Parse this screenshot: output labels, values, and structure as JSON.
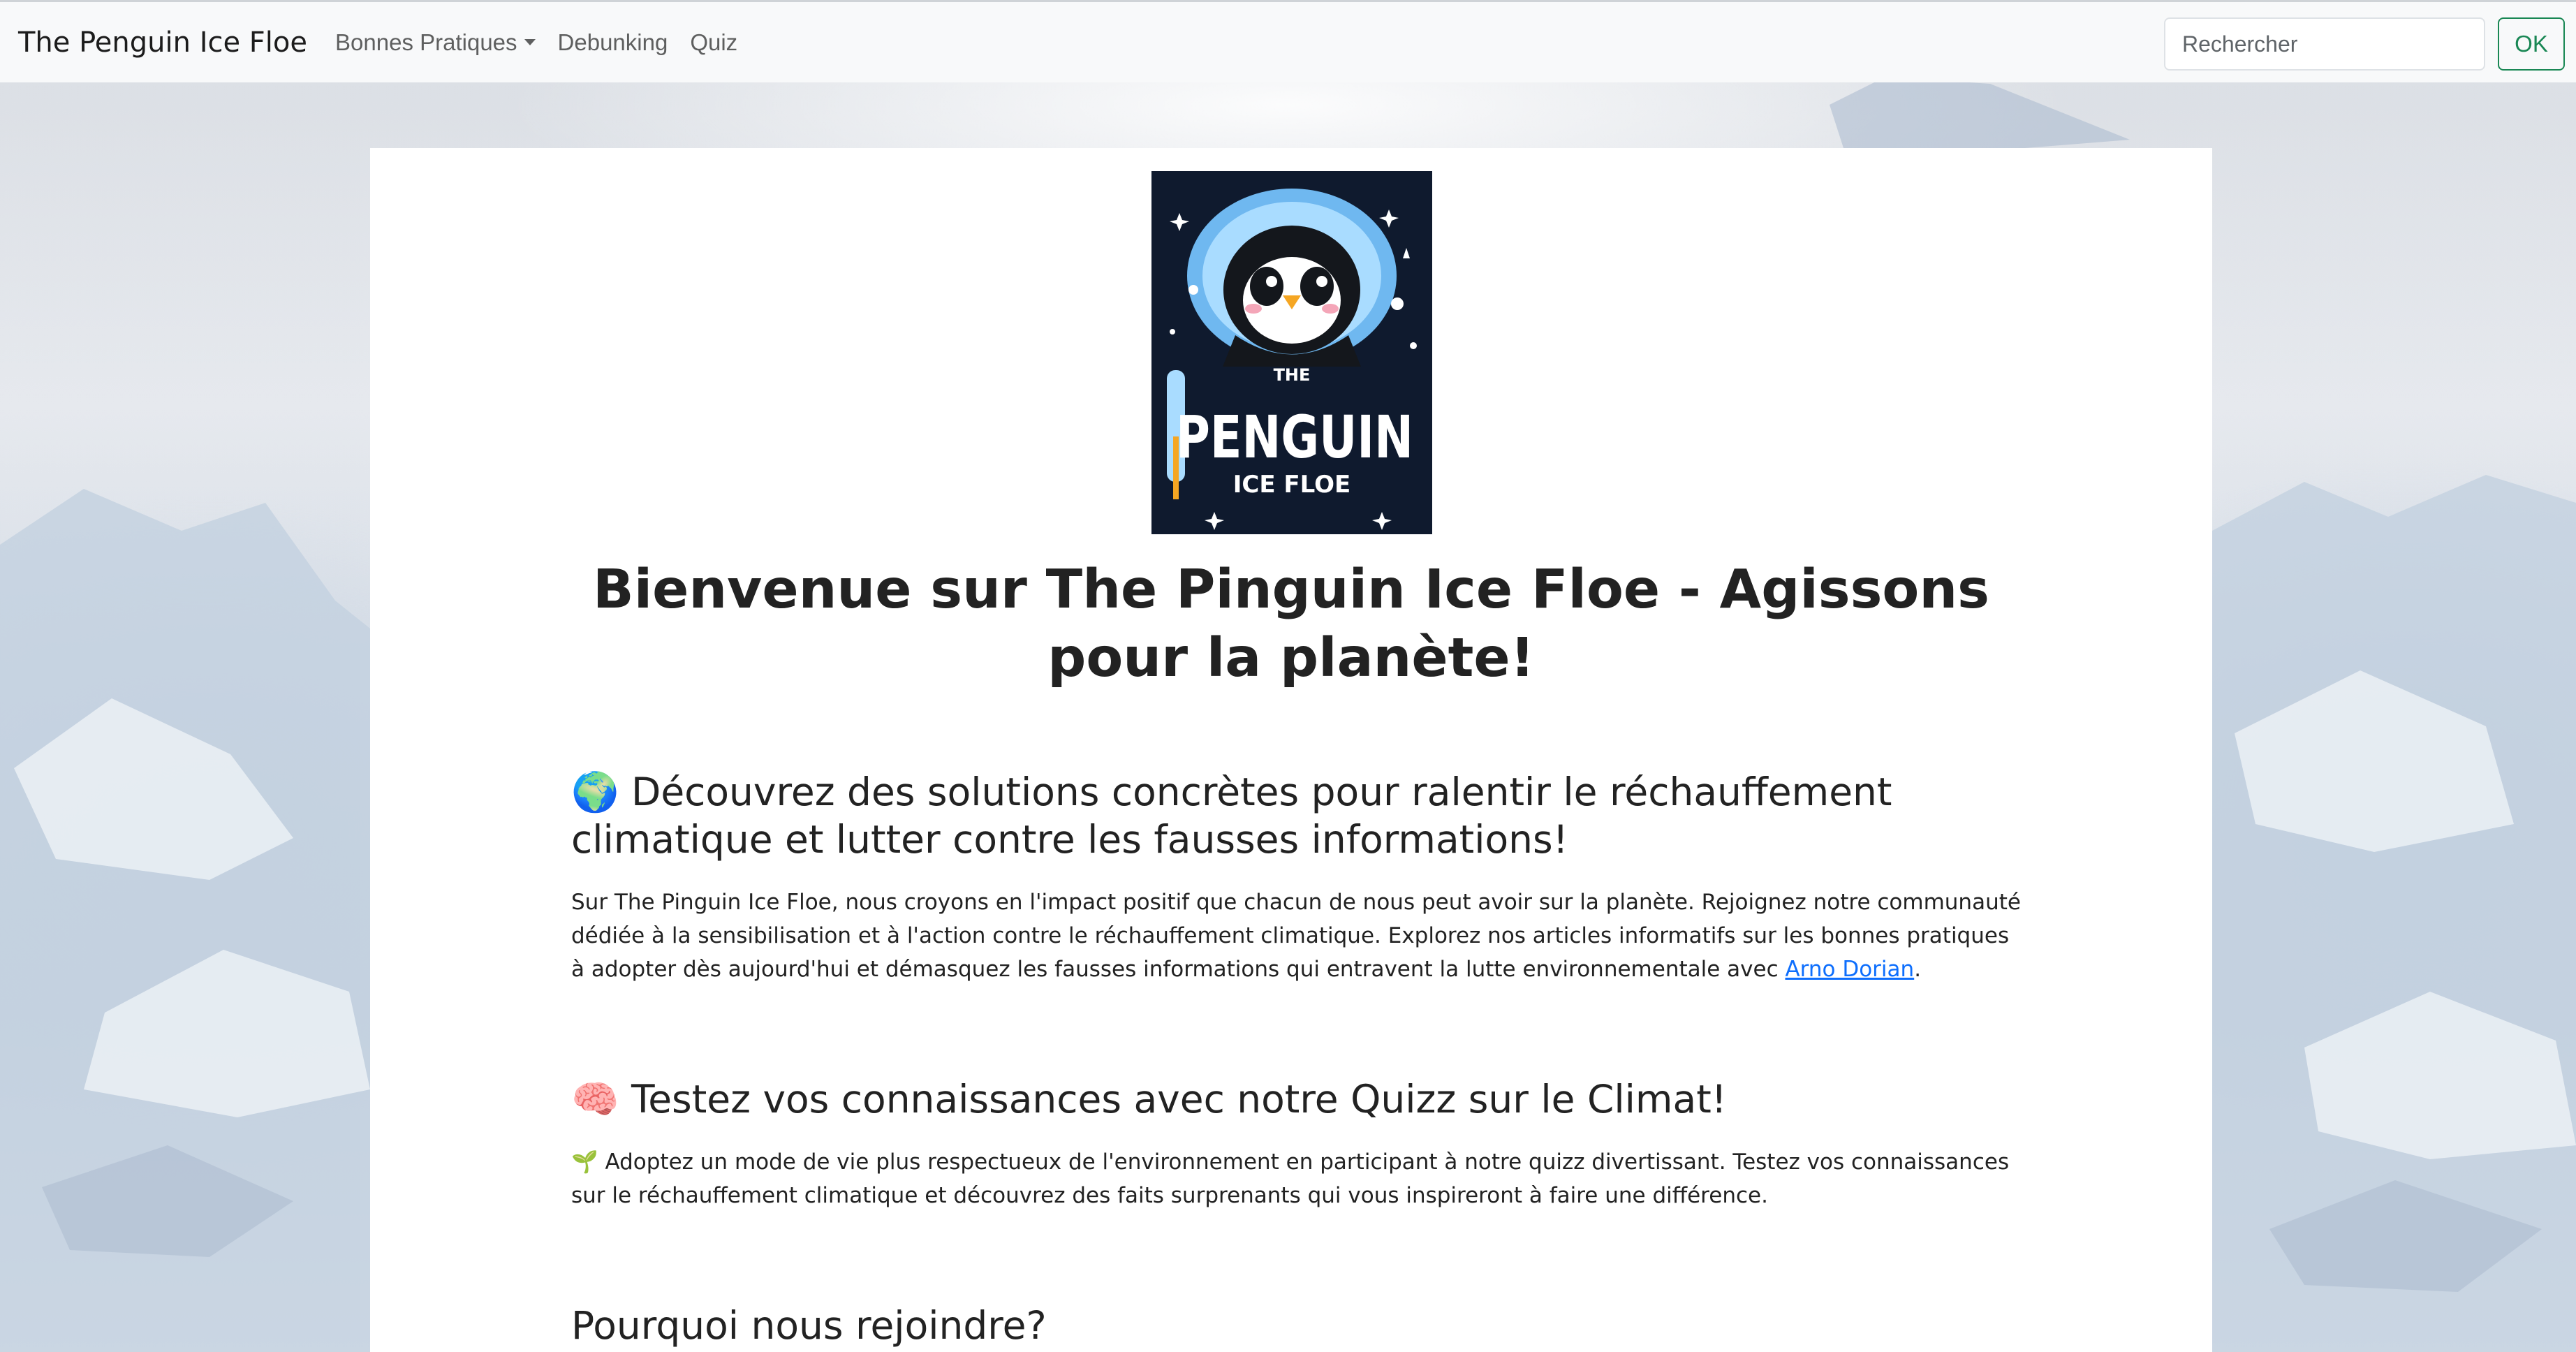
{
  "navbar": {
    "brand": "The Penguin Ice Floe",
    "links": [
      {
        "label": "Bonnes Pratiques",
        "dropdown": true
      },
      {
        "label": "Debunking"
      },
      {
        "label": "Quiz"
      }
    ],
    "search_placeholder": "Rechercher",
    "search_button": "OK"
  },
  "logo": {
    "text_the": "THE",
    "text_penguin": "PENGUIN",
    "text_ice_floe": "ICE FLOE"
  },
  "main": {
    "title": "Bienvenue sur The Pinguin Ice Floe - Agissons pour la planète!",
    "section1": {
      "heading": "🌍 Découvrez des solutions concrètes pour ralentir le réchauffement climatique et lutter contre les fausses informations!",
      "text_before": "Sur The Pinguin Ice Floe, nous croyons en l'impact positif que chacun de nous peut avoir sur la planète. Rejoignez notre communauté dédiée à la sensibilisation et à l'action contre le réchauffement climatique. Explorez nos articles informatifs sur les bonnes pratiques à adopter dès aujourd'hui et démasquez les fausses informations qui entravent la lutte environnementale avec ",
      "link": "Arno Dorian",
      "text_after": "."
    },
    "section2": {
      "heading": "🧠 Testez vos connaissances avec notre Quizz sur le Climat!",
      "text": "🌱 Adoptez un mode de vie plus respectueux de l'environnement en participant à notre quizz divertissant. Testez vos connaissances sur le réchauffement climatique et découvrez des faits surprenants qui vous inspireront à faire une différence."
    },
    "section3": {
      "heading": "Pourquoi nous rejoindre?"
    }
  },
  "colors": {
    "navbar_bg": "#f8f9fa",
    "link": "#0d6efd",
    "ok_button": "#198754",
    "logo_bg": "#0f1a2e"
  }
}
